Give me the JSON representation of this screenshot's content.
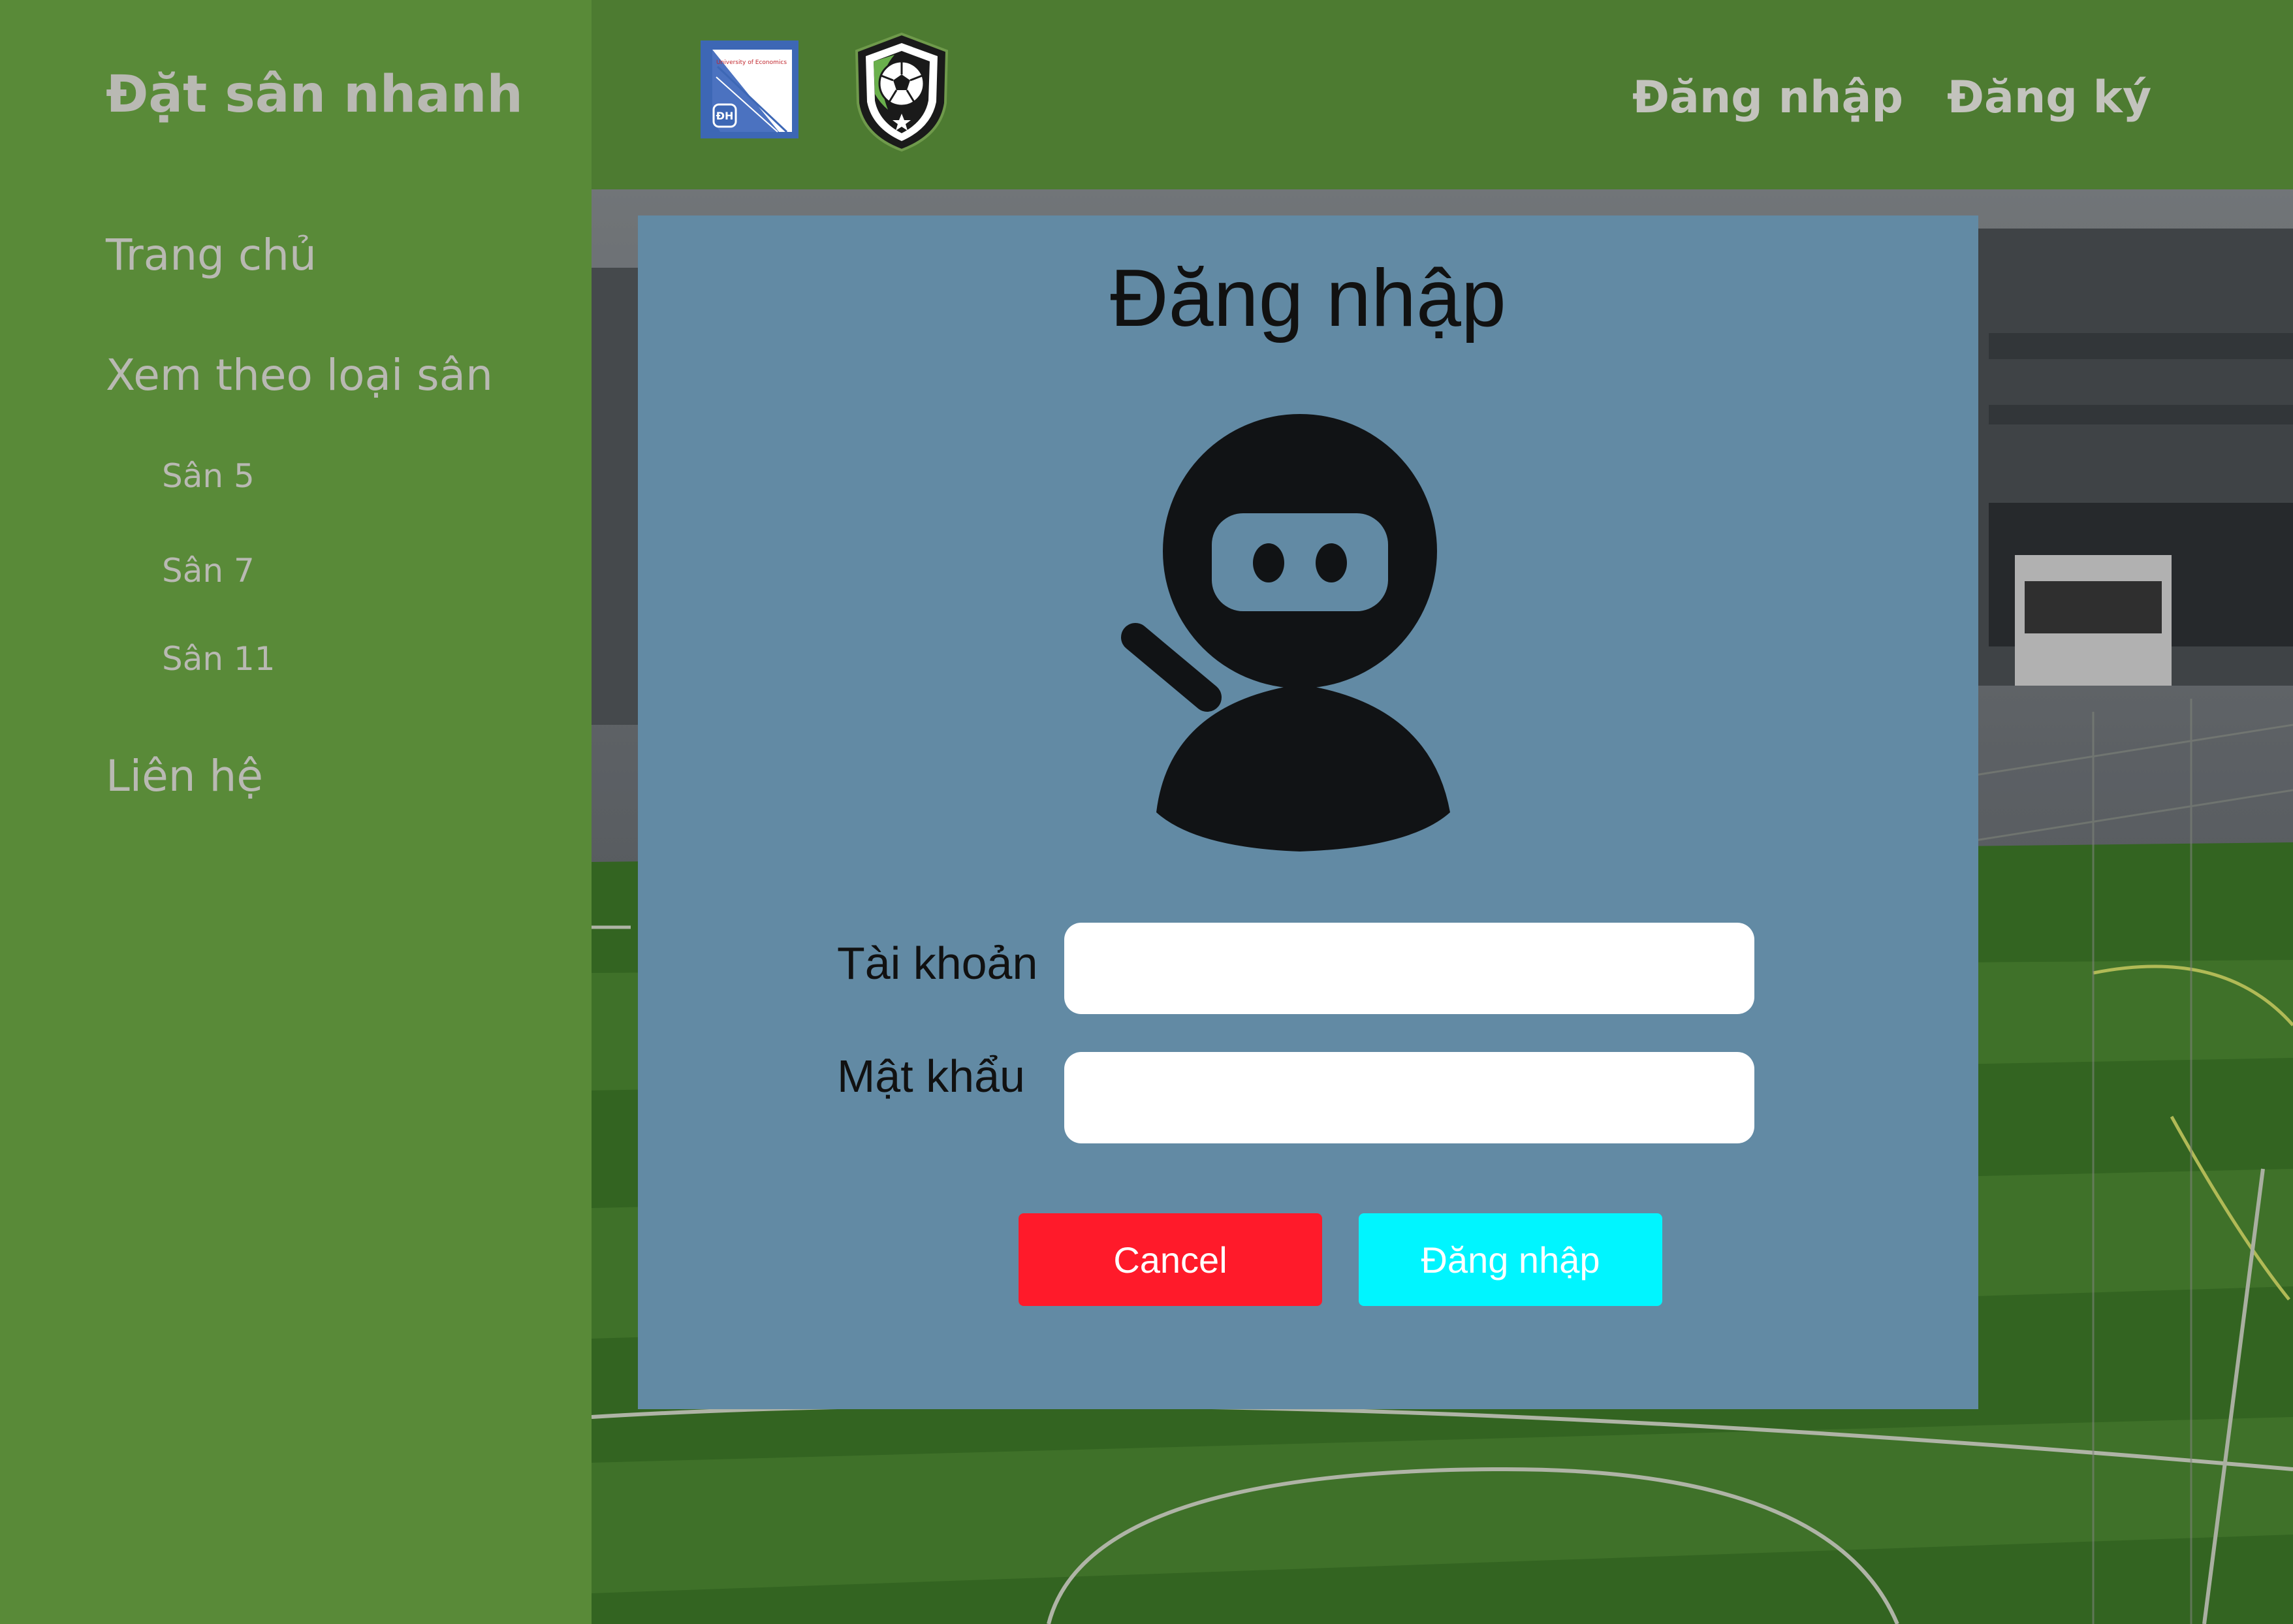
{
  "sidebar": {
    "brand": "Đặt sân nhanh",
    "items": [
      {
        "label": "Trang chủ"
      },
      {
        "label": "Xem theo loại sân"
      },
      {
        "label": "Liên hệ"
      }
    ],
    "sub_items": [
      {
        "label": "Sân 5"
      },
      {
        "label": "Sân 7"
      },
      {
        "label": "Sân 11"
      }
    ]
  },
  "header": {
    "login_link": "Đăng nhập",
    "register_link": "Đăng ký",
    "university_logo_text": "University of Economics",
    "university_logo_abbr": "ĐH"
  },
  "modal": {
    "title": "Đăng nhập",
    "username_label": "Tài khoản",
    "username_value": "",
    "password_label": "Mật khẩu",
    "password_value": "",
    "cancel_label": "Cancel",
    "submit_label": "Đăng nhập"
  },
  "colors": {
    "sidebar_bg": "#598a38",
    "topbar_bg": "#4d7b31",
    "modal_bg": "#628aa4",
    "cancel_button": "#ff1a2a",
    "submit_button": "#00f5ff"
  }
}
